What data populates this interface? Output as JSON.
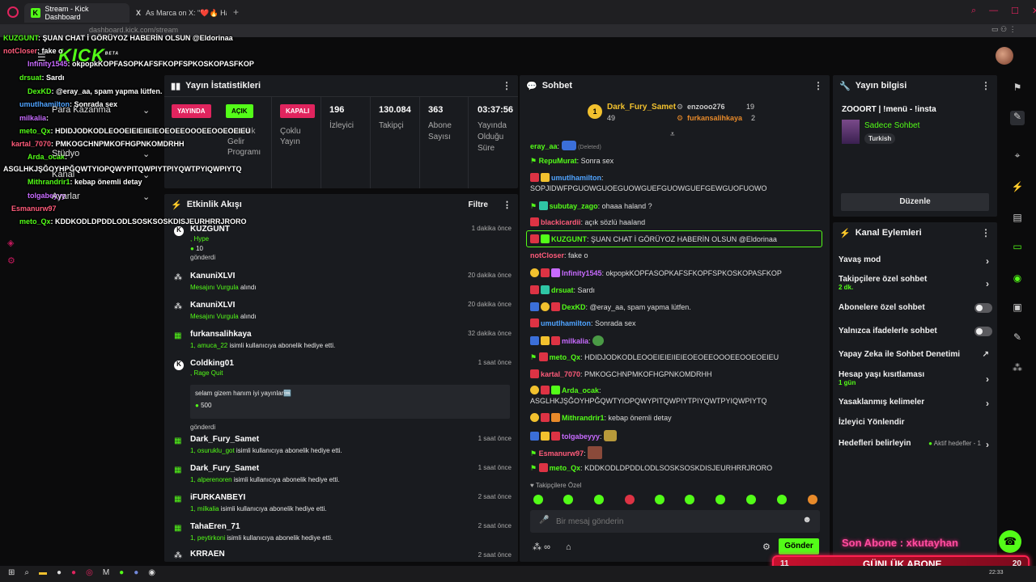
{
  "browser": {
    "tabs": [
      {
        "label": "Stream - Kick Dashboard"
      },
      {
        "label": "As Marca on X: \"❤️🔥 Ha"
      }
    ],
    "url": "dashboard.kick.com/stream"
  },
  "logo": "KICK",
  "logo_badge": "BETA",
  "stats": {
    "title": "Yayın İstatistikleri",
    "live_tag": "YAYINDA",
    "partner_tag": "AÇIK",
    "partner_label": "Ortaklık Gelir Programı",
    "multi_tag": "KAPALI",
    "multi_label": "Çoklu Yayın",
    "viewers": "196",
    "viewers_label": "İzleyici",
    "followers": "130.084",
    "followers_label": "Takipçi",
    "subs": "363",
    "subs_label": "Abone Sayısı",
    "uptime": "03:37:56",
    "uptime_label": "Yayında Olduğu Süre"
  },
  "activity": {
    "title": "Etkinlik Akışı",
    "filter": "Filtre",
    "events": [
      {
        "name": "KUZGUNT",
        "line1": ", Hype",
        "amount": "10",
        "line2": "gönderdi",
        "time": "1 dakika önce"
      },
      {
        "name": "KanuniXLVI",
        "prefix": "Mesajını Vurgula",
        "rest": " alındı",
        "time": "20 dakika önce"
      },
      {
        "name": "KanuniXLVI",
        "prefix": "Mesajını Vurgula",
        "rest": " alındı",
        "time": "20 dakika önce"
      },
      {
        "name": "furkansalihkaya",
        "prefix": "1, amuca_22",
        "rest": " isimli kullanıcıya abonelik hediye etti.",
        "time": "32 dakika önce"
      },
      {
        "name": "Coldking01",
        "line1": ", Rage Quit",
        "msg": "selam gizem hanım iyi yayınlar🆒",
        "amount": "500",
        "line2": "gönderdi",
        "time": "1 saat önce"
      },
      {
        "name": "Dark_Fury_Samet",
        "prefix": "1, osuruklu_got",
        "rest": " isimli kullanıcıya abonelik hediye etti.",
        "time": "1 saat önce"
      },
      {
        "name": "Dark_Fury_Samet",
        "prefix": "1, alperenoren",
        "rest": " isimli kullanıcıya abonelik hediye etti.",
        "time": "1 saat önce"
      },
      {
        "name": "iFURKANBEYI",
        "prefix": "1, milkalia",
        "rest": " isimli kullanıcıya abonelik hediye etti.",
        "time": "2 saat önce"
      },
      {
        "name": "TahaEren_71",
        "prefix": "1, peytirkoni",
        "rest": " isimli kullanıcıya abonelik hediye etti.",
        "time": "2 saat önce"
      },
      {
        "name": "KRRAEN",
        "time": "2 saat önce"
      }
    ]
  },
  "chat": {
    "title": "Sohbet",
    "top1": {
      "name": "Dark_Fury_Samet",
      "count": "49"
    },
    "top2": {
      "name": "enzooo276",
      "count": "19"
    },
    "top3": {
      "name": "furkansalihkaya",
      "count": "2"
    },
    "messages": [
      {
        "user": "eray_aa",
        "color": "#53fc18",
        "text": "(Deleted)"
      },
      {
        "user": "RepuMurat",
        "color": "#53fc18",
        "text": ": Sonra sex"
      },
      {
        "user": "umutlhamilton",
        "color": "#4fa3ff",
        "text": ":"
      },
      {
        "user": "",
        "color": "#fff",
        "text": "SOPJIDWFPGUOWGUOEGUOWGUEFGUOWGUEFGEWGUOFUOWO"
      },
      {
        "user": "subutay_zago",
        "color": "#53fc18",
        "text": ": ohaaa haland ?"
      },
      {
        "user": "blackicardii",
        "color": "#ff5b7a",
        "text": ": açık sözlü haaland"
      },
      {
        "user": "KUZGUNT",
        "color": "#53fc18",
        "text": ": ŞUAN CHAT İ GÖRÜYOZ HABERİN OLSUN @Eldorinaa"
      },
      {
        "user": "notCloser",
        "color": "#ff5b7a",
        "text": ": fake o"
      },
      {
        "user": "Infinity1545",
        "color": "#c86bff",
        "text": ": okpopkKOPFASOPKAFSFKOPFSPKOSKOPASFKOP"
      },
      {
        "user": "drsuat",
        "color": "#53fc18",
        "text": ": Sardı"
      },
      {
        "user": "DexKD",
        "color": "#53fc18",
        "text": ": @eray_aa, spam yapma lütfen."
      },
      {
        "user": "umutlhamilton",
        "color": "#4fa3ff",
        "text": ": Sonrada sex"
      },
      {
        "user": "milkalia",
        "color": "#c86bff",
        "text": ":"
      },
      {
        "user": "meto_Qx",
        "color": "#53fc18",
        "text": ": HDIDJODKODLEOOEIEIEIIEIEOEOEEOOOEEOOEOEIEU"
      },
      {
        "user": "kartal_7070",
        "color": "#ff5b7a",
        "text": ": PMKOGCHNPMKOFHGPNKOMDRHH"
      },
      {
        "user": "Arda_ocak",
        "color": "#53fc18",
        "text": ":"
      },
      {
        "user": "",
        "color": "#fff",
        "text": "ASGLHKJŞĞOYHPĞQWTYIOPQWYPITQWPIYTPIYQWTPYIQWPIYTQ"
      },
      {
        "user": "Mithrandrir1",
        "color": "#53fc18",
        "text": ": kebap önemli detay"
      },
      {
        "user": "tolgabeyyy",
        "color": "#c86bff",
        "text": ":"
      },
      {
        "user": "Esmanurw97",
        "color": "#ff5b7a",
        "text": ":"
      },
      {
        "user": "meto_Qx",
        "color": "#53fc18",
        "text": ": KDDKODLDPDDLODLSOSKSOSKDISJEURHRRJRORO"
      }
    ],
    "followers_only": "Takipçilere Özel",
    "placeholder": "Bir mesaj gönderin",
    "send": "Gönder"
  },
  "info": {
    "title": "Yayın bilgisi",
    "stream_title": "ZOOORT | !menü - !insta",
    "category": "Sadece Sohbet",
    "language": "Turkish",
    "edit": "Düzenle"
  },
  "actions": {
    "title": "Kanal Eylemleri",
    "slow": "Yavaş mod",
    "followers": "Takipçilere özel sohbet",
    "followers_sub": "2 dk.",
    "subs": "Abonelere özel sohbet",
    "emotes": "Yalnızca ifadelerle sohbet",
    "ai": "Yapay Zeka ile Sohbet Denetimi",
    "age": "Hesap yaşı kısıtlaması",
    "age_sub": "1 gün",
    "banned": "Yasaklanmış kelimeler",
    "redirect": "İzleyici Yönlendir",
    "goals": "Hedefleri belirleyin",
    "goals_status": "Aktif hedefler - 1"
  },
  "sidebar_overlay": {
    "items": [
      "Para Kazanma",
      "Stüdyo",
      "Kanal",
      "Ayarlar"
    ]
  },
  "overlay": {
    "last_sub": "Son Abone : xkutayhan",
    "daily_left": "11",
    "daily_label": "GÜNLÜK ABONE",
    "daily_right": "20"
  },
  "taskbar": {
    "time": "22:33"
  }
}
